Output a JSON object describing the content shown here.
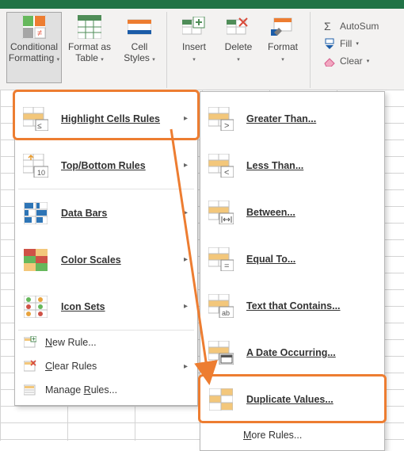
{
  "ribbon": {
    "conditional_formatting": [
      "Conditional",
      "Formatting"
    ],
    "format_as_table": [
      "Format as",
      "Table"
    ],
    "cell_styles": [
      "Cell",
      "Styles"
    ],
    "insert": "Insert",
    "delete": "Delete",
    "format": "Format",
    "autosum": "AutoSum",
    "fill": "Fill",
    "clear": "Clear"
  },
  "menu_left": {
    "highlight_cells_rules": "Highlight Cells Rules",
    "top_bottom_rules": "Top/Bottom Rules",
    "data_bars": "Data Bars",
    "color_scales": "Color Scales",
    "icon_sets": "Icon Sets",
    "new_rule": "New Rule...",
    "clear_rules": "Clear Rules",
    "manage_rules": "Manage Rules..."
  },
  "menu_right": {
    "greater_than": "Greater Than...",
    "less_than": "Less Than...",
    "between": "Between...",
    "equal_to": "Equal To...",
    "text_that_contains": "Text that Contains...",
    "a_date_occurring": "A Date Occurring...",
    "duplicate_values": "Duplicate Values...",
    "more_rules": "More Rules..."
  }
}
